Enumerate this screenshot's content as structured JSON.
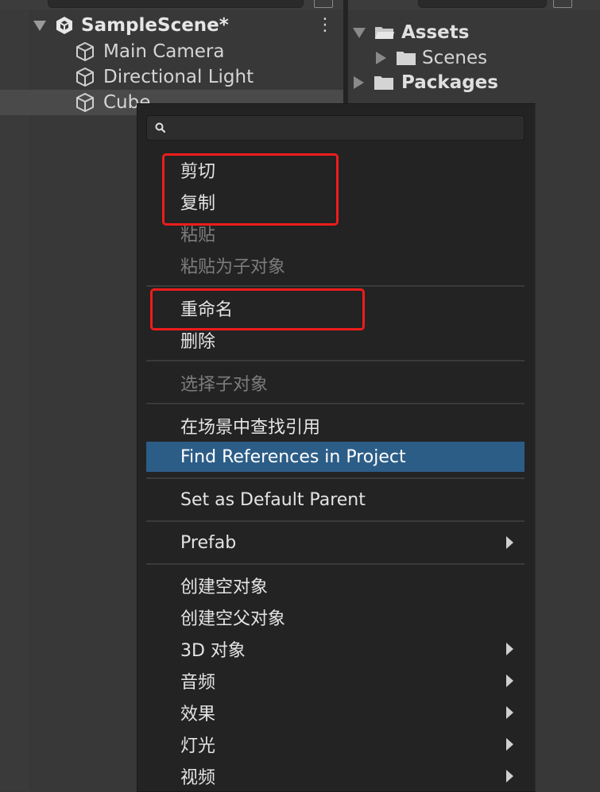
{
  "hierarchy": {
    "scene_name": "SampleScene*",
    "items": [
      {
        "label": "Main Camera"
      },
      {
        "label": "Directional Light"
      },
      {
        "label": "Cube"
      }
    ]
  },
  "project": {
    "assets_label": "Assets",
    "scenes_label": "Scenes",
    "packages_label": "Packages"
  },
  "context_menu": {
    "search_placeholder": "",
    "items": {
      "cut": "剪切",
      "copy": "复制",
      "paste": "粘贴",
      "paste_as_child": "粘贴为子对象",
      "rename": "重命名",
      "delete": "删除",
      "select_children": "选择子对象",
      "find_refs_in_scene": "在场景中查找引用",
      "find_refs_in_project": "Find References in Project",
      "set_default_parent": "Set as Default Parent",
      "prefab": "Prefab",
      "create_empty": "创建空对象",
      "create_empty_parent": "创建空父对象",
      "object_3d": "3D 对象",
      "audio": "音频",
      "effects": "效果",
      "light": "灯光",
      "video": "视频"
    }
  },
  "colors": {
    "highlight": "#2c5d87",
    "annotation_box": "#ee1c1c"
  },
  "icons": {
    "scene": "unity-logo-icon",
    "gameobject": "cube-icon",
    "folder": "folder-icon",
    "search": "search-icon",
    "more": "kebab-menu-icon",
    "submenu": "chevron-right-icon"
  }
}
